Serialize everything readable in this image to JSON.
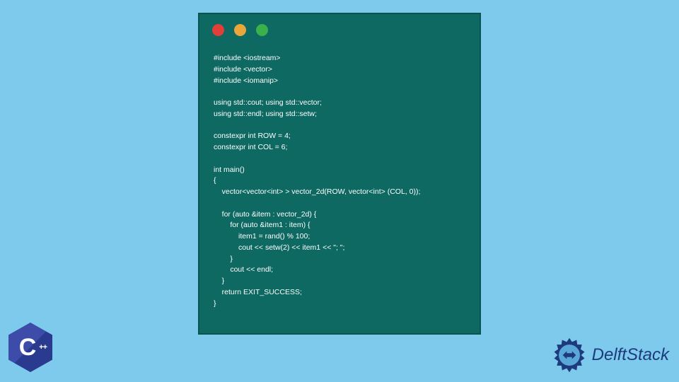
{
  "code": {
    "text": "#include <iostream>\n#include <vector>\n#include <iomanip>\n\nusing std::cout; using std::vector;\nusing std::endl; using std::setw;\n\nconstexpr int ROW = 4;\nconstexpr int COL = 6;\n\nint main()\n{\n    vector<vector<int> > vector_2d(ROW, vector<int> (COL, 0));\n\n    for (auto &item : vector_2d) {\n        for (auto &item1 : item) {\n            item1 = rand() % 100;\n            cout << setw(2) << item1 << \"; \";\n        }\n        cout << endl;\n    }\n    return EXIT_SUCCESS;\n}"
  },
  "window": {
    "colors": {
      "red": "#e13f38",
      "yellow": "#e9a63a",
      "green": "#3ab14a",
      "bg": "#0d6962"
    }
  },
  "logos": {
    "cpp": "C",
    "cpp_plus": "++",
    "delft": "DelftStack"
  }
}
